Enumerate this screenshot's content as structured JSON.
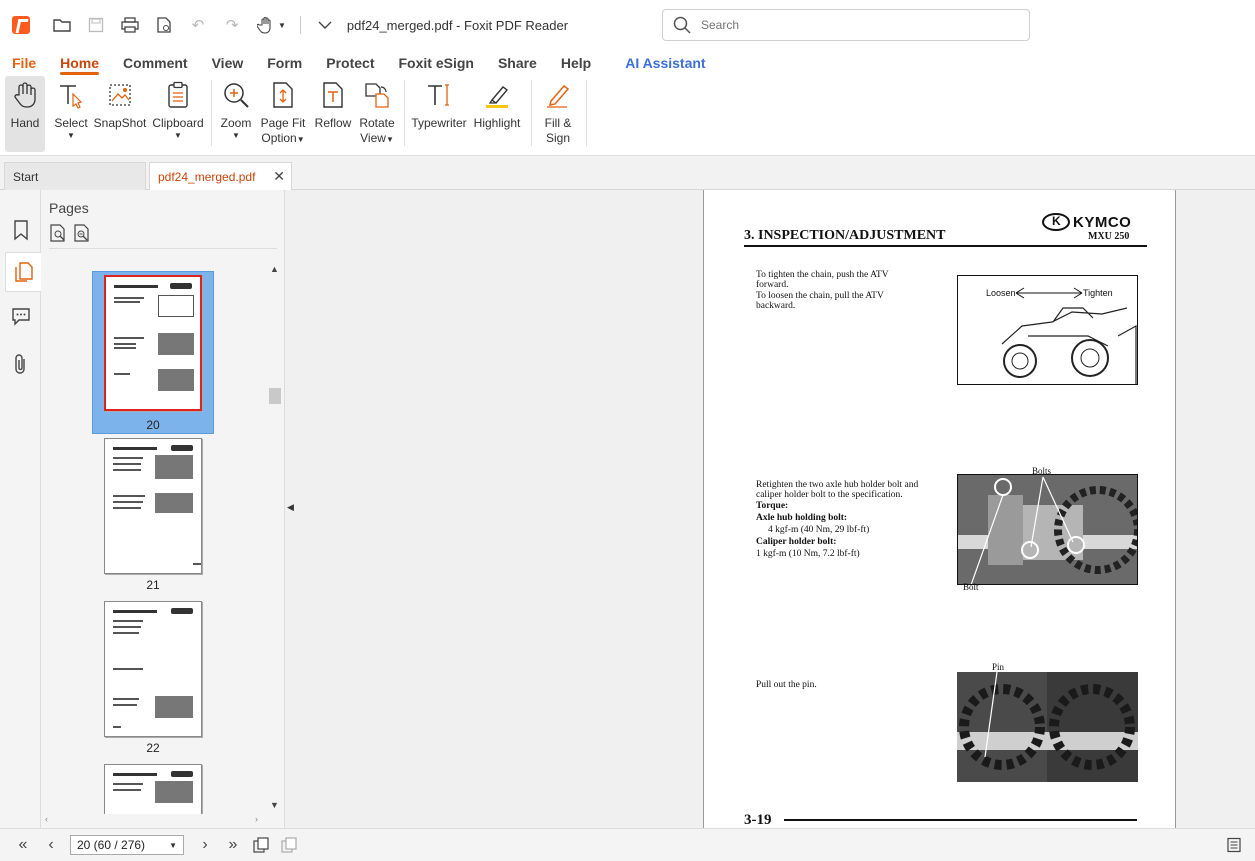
{
  "titlebar": {
    "doc_title": "pdf24_merged.pdf - Foxit PDF Reader",
    "search_placeholder": "Search",
    "icons": [
      "foxit-logo-icon",
      "open-folder-icon",
      "save-icon",
      "print-icon",
      "page-setup-icon",
      "undo-icon",
      "redo-icon",
      "hand-tool-icon",
      "customize-qat-icon"
    ]
  },
  "menu": [
    "File",
    "Home",
    "Comment",
    "View",
    "Form",
    "Protect",
    "Foxit eSign",
    "Share",
    "Help",
    "AI Assistant"
  ],
  "ribbon": {
    "hand": "Hand",
    "select": "Select",
    "snapshot": "SnapShot",
    "clipboard": "Clipboard",
    "zoom": "Zoom",
    "pagefit_1": "Page Fit",
    "pagefit_2": "Option",
    "reflow": "Reflow",
    "rotate_1": "Rotate",
    "rotate_2": "View",
    "typewriter": "Typewriter",
    "highlight": "Highlight",
    "fillsign_1": "Fill &",
    "fillsign_2": "Sign"
  },
  "tabs": {
    "start": "Start",
    "current": "pdf24_merged.pdf"
  },
  "pages_panel": {
    "title": "Pages",
    "thumbnails": [
      "20",
      "21",
      "22"
    ]
  },
  "page": {
    "heading": "3. INSPECTION/ADJUSTMENT",
    "logo": "KYMCO",
    "model": "MXU 250",
    "text1a": "To tighten the chain, push the ATV forward.",
    "text1b": "To loosen the chain, pull the ATV backward.",
    "fig1_loosen": "Loosen",
    "fig1_tighten": "Tighten",
    "text2": "Retighten the two axle hub holder bolt and caliper holder bolt to the specification.",
    "torque": "Torque:",
    "axle_label": "Axle hub holding bolt:",
    "axle_value": "4 kgf-m (40 Nm, 29 lbf-ft)",
    "caliper_label": "Caliper holder bolt:",
    "caliper_value": "1 kgf-m (10 Nm, 7.2 lbf-ft)",
    "fig2_bolts": "Bolts",
    "fig2_bolt": "Bolt",
    "text3": "Pull out the pin.",
    "fig3_pin": "Pin",
    "footer": "3-19"
  },
  "statusbar": {
    "page_indicator": "20 (60 / 276)"
  }
}
